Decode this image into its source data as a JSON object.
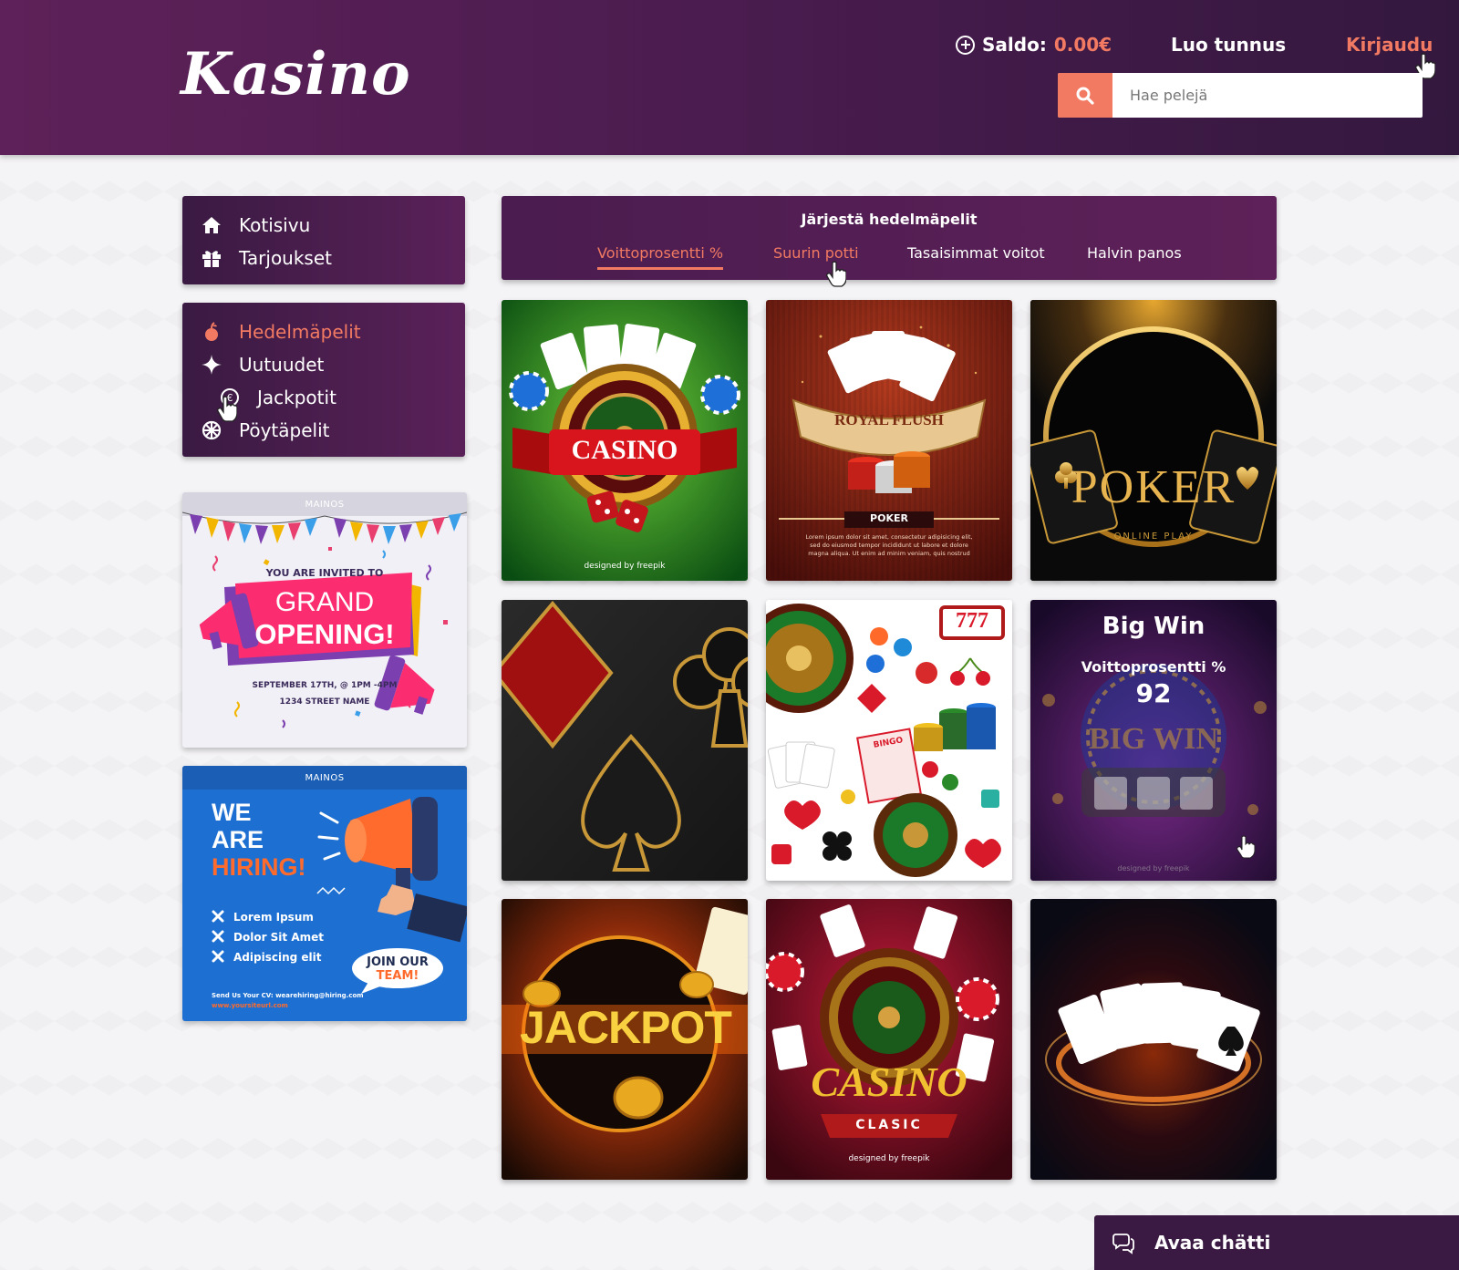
{
  "header": {
    "logo": "Kasino",
    "saldo_label": "Saldo:",
    "saldo_amount": "0.00€",
    "create_account": "Luo tunnus",
    "login": "Kirjaudu",
    "search_placeholder": "Hae pelejä"
  },
  "sidebar": {
    "main_menu": [
      {
        "label": "Kotisivu",
        "icon": "home-icon"
      },
      {
        "label": "Tarjoukset",
        "icon": "gift-icon"
      }
    ],
    "game_menu": [
      {
        "label": "Hedelmäpelit",
        "icon": "fruit-icon",
        "active": true
      },
      {
        "label": "Uutuudet",
        "icon": "sparkle-icon"
      },
      {
        "label": "Jackpotit",
        "icon": "euro-coin-icon"
      },
      {
        "label": "Pöytäpelit",
        "icon": "roulette-icon"
      }
    ],
    "ads": [
      {
        "label": "MAINOS",
        "line1": "YOU ARE INVITED TO",
        "line2": "GRAND",
        "line3": "OPENING!",
        "line4": "SEPTEMBER 17TH, @ 1PM -4PM",
        "line5": "1234 STREET NAME"
      },
      {
        "label": "MAINOS",
        "we": "WE",
        "are": "ARE",
        "hiring": "HIRING!",
        "bullets": [
          "Lorem Ipsum",
          "Dolor Sit Amet",
          "Adipiscing elit"
        ],
        "join1": "JOIN OUR",
        "join2": "TEAM!",
        "cv": "Send Us Your CV: wearehiring@hiring.com",
        "url": "www.yoursiteurl.com"
      }
    ]
  },
  "sort": {
    "title": "Järjestä hedelmäpelit",
    "tabs": [
      {
        "label": "Voittoprosentti %",
        "active": true
      },
      {
        "label": "Suurin potti",
        "hover": true
      },
      {
        "label": "Tasaisimmat voitot"
      },
      {
        "label": "Halvin panos"
      }
    ]
  },
  "games": [
    {
      "name": "casino-roulette",
      "title": "CASINO",
      "credit": "designed by freepik"
    },
    {
      "name": "royal-flush",
      "title": "ROYAL FLUSH",
      "subtitle": "POKER",
      "body": "Lorem ipsum dolor sit amet, consectetur adipisicing elit, sed do eiusmod tempor incididunt ut labore et dolore magna aliqua. Ut enim ad minim veniam, quis nostrud"
    },
    {
      "name": "poker-online",
      "title": "POKER",
      "subtitle": "ONLINE PLAY"
    },
    {
      "name": "card-suits",
      "title": ""
    },
    {
      "name": "casino-elements",
      "title": "777",
      "subtitle": "BINGO"
    },
    {
      "name": "big-win",
      "title": "Big Win",
      "stat_label": "Voittoprosentti %",
      "stat_value": "92",
      "logo": "BIG WIN",
      "credit": "designed by freepik"
    },
    {
      "name": "jackpot",
      "title": "JACKPOT"
    },
    {
      "name": "casino-clasic",
      "title": "CASINO",
      "subtitle": "CLASIC",
      "credit": "designed by freepik"
    },
    {
      "name": "flying-cards",
      "title": ""
    }
  ],
  "chat": {
    "label": "Avaa chätti"
  },
  "colors": {
    "accent": "#f27a62",
    "header": "#4a1c4f",
    "panel": "#3a1a42"
  }
}
